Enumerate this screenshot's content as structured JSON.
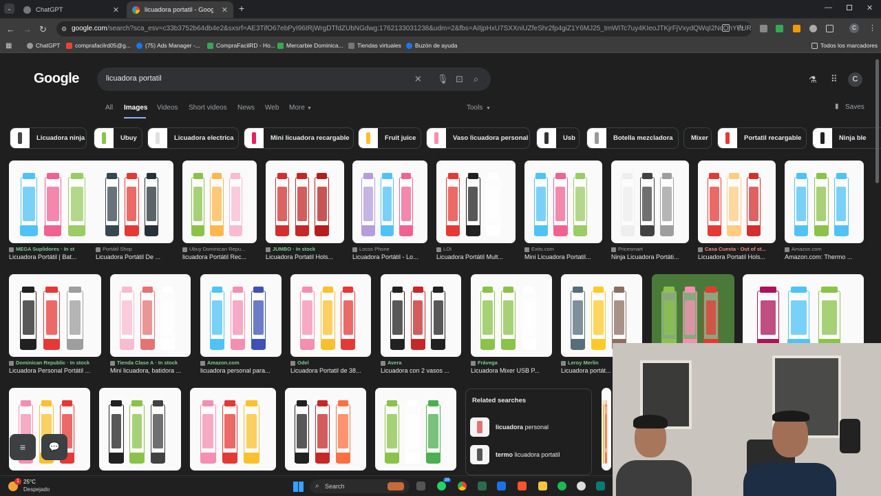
{
  "tabs": [
    {
      "label": "ChatGPT",
      "active": false
    },
    {
      "label": "licuadora portatil - Google Sear",
      "active": true
    }
  ],
  "address": {
    "host": "google.com",
    "rest": "/search?sca_esv=c33b3752b64db4e2&sxsrf=AE3TifO67ebPyI96IRjWrgDTfdZUbNGdwg:1762133031238&udm=2&fbs=AIIjpHxU7SXXniUZfeShr2fp4giZ1Y6MJ25_tmWITc7uy4KIeoJTKjrFjVxydQWqI2NcOhYPURIv2wPgv..."
  },
  "bookmarks": [
    "ChatGPT",
    "comprafacilrd05@g...",
    "(75) Ads Manager -...",
    "CompraFacilRD - Ho...",
    "Mercarbie Dominica...",
    "Tiendas virtuales",
    "Buzón de ayuda",
    "Todos los marcadores"
  ],
  "search": {
    "query": "licuadora portatil",
    "logo": "Google",
    "saves": "Saves",
    "tools": "Tools",
    "avatar": "C"
  },
  "filters": [
    "All",
    "Images",
    "Videos",
    "Short videos",
    "News",
    "Web",
    "More"
  ],
  "chips": [
    "Licuadora ninja",
    "Ubuy",
    "Licuadora electrica",
    "Mini licuadora recargable",
    "Fruit juice",
    "Vaso licuadora personal",
    "Usb",
    "Botella mezcladora",
    "Mixer",
    "Portatil recargable",
    "Ninja ble"
  ],
  "row1": [
    {
      "source": "MEGA Suplidores · In st",
      "status": "In st",
      "title": "Licuadora Portátil | Bat..."
    },
    {
      "source": "Portátil Shop",
      "status": "",
      "title": "Licuadora Portátil De ..."
    },
    {
      "source": "Ubuy Dominican Repu...",
      "status": "",
      "title": "licuadora Portátil Rec..."
    },
    {
      "source": "JUMBO · In stock",
      "status": "In stock",
      "title": "Licuadora Portatil Hols..."
    },
    {
      "source": "Locos Phone",
      "status": "",
      "title": "Licuadora Portátil - Lo..."
    },
    {
      "source": "LOI",
      "status": "",
      "title": "Licuadora Portátil Mult..."
    },
    {
      "source": "Exito.com",
      "status": "",
      "title": "Mini Licuadora Portatil..."
    },
    {
      "source": "Pricesmart",
      "status": "",
      "title": "Ninja Licuadora Portáti..."
    },
    {
      "source": "Casa Cuesta · Out of st...",
      "status": "Out of st...",
      "title": "Licuadora Portatil Hols..."
    },
    {
      "source": "Amazon.com",
      "status": "",
      "title": "Amazon.com: Thermo ..."
    }
  ],
  "row2": [
    {
      "source": "Dominican Republic · In stock",
      "title": "Licuadora Personal Portátil ..."
    },
    {
      "source": "Tienda Clase A · In stock",
      "title": "Mini licuadora, batidora ..."
    },
    {
      "source": "Amazon.com",
      "title": "licuadora personal para..."
    },
    {
      "source": "Odel",
      "title": "Licuadora Portatil de 38..."
    },
    {
      "source": "Avera",
      "title": "Licuadora con 2 vasos ..."
    },
    {
      "source": "Frávega",
      "title": "Licuadora Mixer USB P..."
    },
    {
      "source": "Leroy Merlin",
      "title": "Licuadora portát..."
    }
  ],
  "related": {
    "heading": "Related searches",
    "items": [
      {
        "bold": "licuadora",
        "rest": " personal"
      },
      {
        "bold": "termo",
        "rest": " licuadora portatil"
      }
    ]
  },
  "taskbar": {
    "weather_temp": "25°C",
    "weather_desc": "Despejado",
    "search": "Search",
    "badge": "1",
    "chat_badge": "39"
  },
  "colors": {
    "accent": "#8ab4f8",
    "stock": "#81c995",
    "out": "#f28b82"
  }
}
